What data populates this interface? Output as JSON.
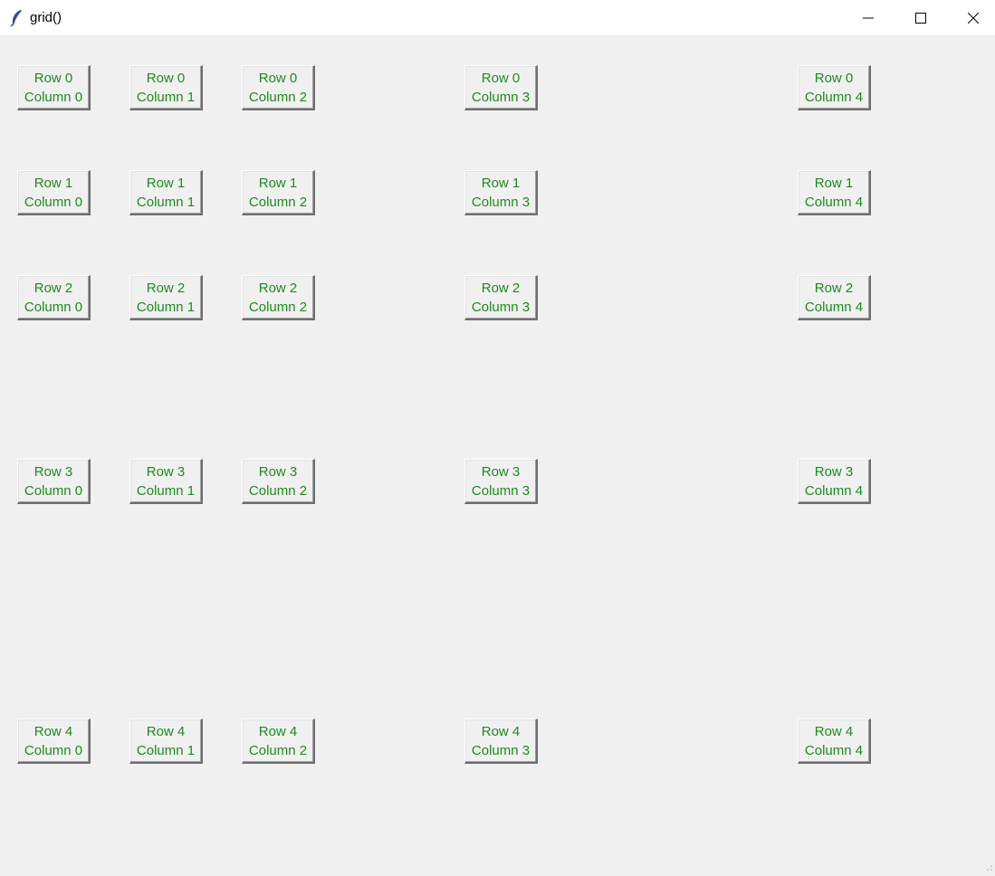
{
  "window": {
    "title": "grid()",
    "app_icon": "feather-icon",
    "controls": [
      "minimize-icon",
      "maximize-icon",
      "close-icon"
    ]
  },
  "colors": {
    "background": "#f0f0f0",
    "button_text": "#1f8a1f",
    "titlebar": "#ffffff"
  },
  "grid": {
    "rows": [
      {
        "cells": [
          {
            "line1": "Row 0",
            "line2": "Column 0"
          },
          {
            "line1": "Row 0",
            "line2": "Column 1"
          },
          {
            "line1": "Row 0",
            "line2": "Column 2"
          },
          {
            "line1": "Row 0",
            "line2": "Column 3"
          },
          {
            "line1": "Row 0",
            "line2": "Column 4"
          }
        ]
      },
      {
        "cells": [
          {
            "line1": "Row 1",
            "line2": "Column 0"
          },
          {
            "line1": "Row 1",
            "line2": "Column 1"
          },
          {
            "line1": "Row 1",
            "line2": "Column 2"
          },
          {
            "line1": "Row 1",
            "line2": "Column 3"
          },
          {
            "line1": "Row 1",
            "line2": "Column 4"
          }
        ]
      },
      {
        "cells": [
          {
            "line1": "Row 2",
            "line2": "Column 0"
          },
          {
            "line1": "Row 2",
            "line2": "Column 1"
          },
          {
            "line1": "Row 2",
            "line2": "Column 2"
          },
          {
            "line1": "Row 2",
            "line2": "Column 3"
          },
          {
            "line1": "Row 2",
            "line2": "Column 4"
          }
        ]
      },
      {
        "cells": [
          {
            "line1": "Row 3",
            "line2": "Column 0"
          },
          {
            "line1": "Row 3",
            "line2": "Column 1"
          },
          {
            "line1": "Row 3",
            "line2": "Column 2"
          },
          {
            "line1": "Row 3",
            "line2": "Column 3"
          },
          {
            "line1": "Row 3",
            "line2": "Column 4"
          }
        ]
      },
      {
        "cells": [
          {
            "line1": "Row 4",
            "line2": "Column 0"
          },
          {
            "line1": "Row 4",
            "line2": "Column 1"
          },
          {
            "line1": "Row 4",
            "line2": "Column 2"
          },
          {
            "line1": "Row 4",
            "line2": "Column 3"
          },
          {
            "line1": "Row 4",
            "line2": "Column 4"
          }
        ]
      }
    ]
  }
}
